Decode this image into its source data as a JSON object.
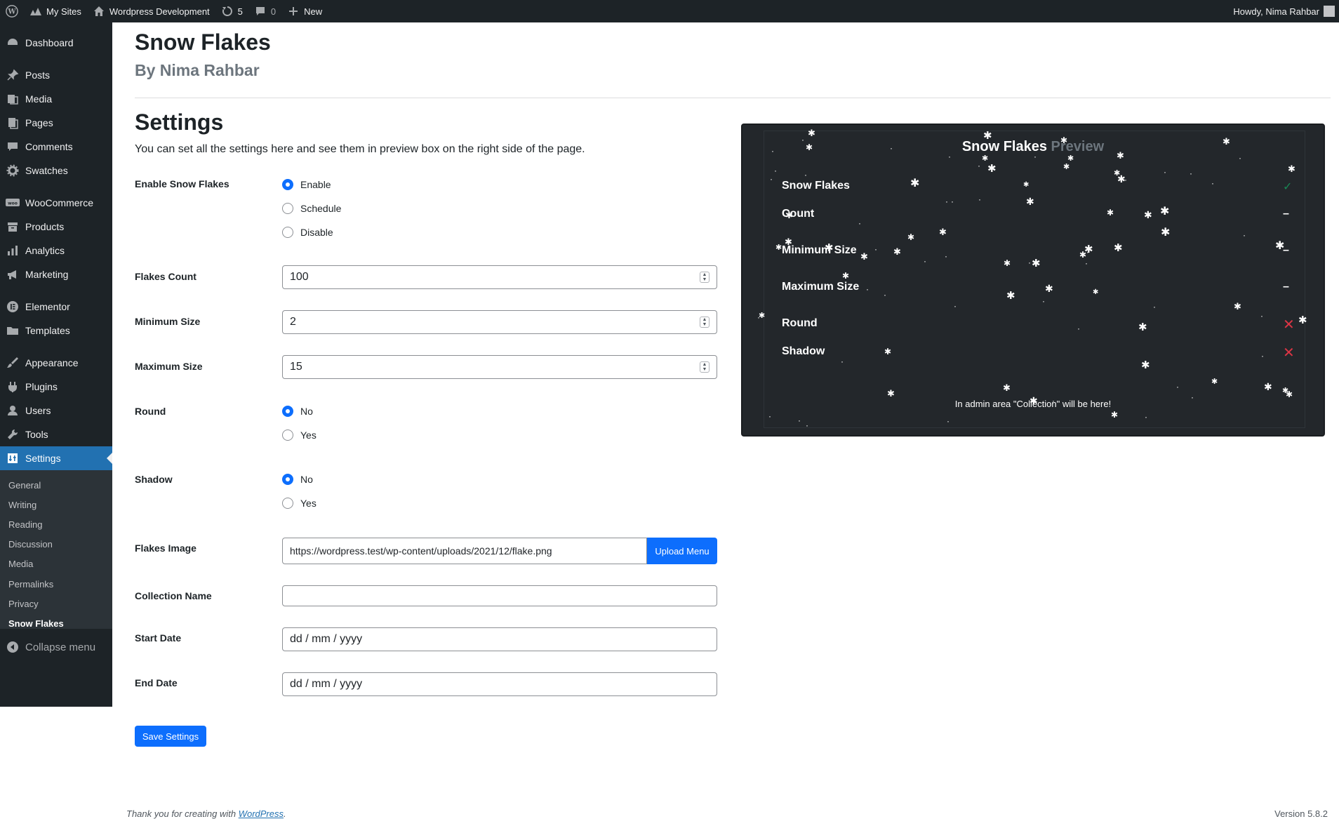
{
  "admin_bar": {
    "my_sites": "My Sites",
    "site_name": "Wordpress Development",
    "updates_count": "5",
    "comments_count": "0",
    "new_label": "New",
    "howdy": "Howdy, Nima Rahbar"
  },
  "sidebar": {
    "items": [
      {
        "label": "Dashboard",
        "icon": "dashboard-icon"
      },
      {
        "label": "Posts",
        "icon": "pin-icon"
      },
      {
        "label": "Media",
        "icon": "media-icon"
      },
      {
        "label": "Pages",
        "icon": "pages-icon"
      },
      {
        "label": "Comments",
        "icon": "comment-icon"
      },
      {
        "label": "Swatches",
        "icon": "gear-icon"
      },
      {
        "label": "WooCommerce",
        "icon": "woo-icon"
      },
      {
        "label": "Products",
        "icon": "archive-icon"
      },
      {
        "label": "Analytics",
        "icon": "bar-chart-icon"
      },
      {
        "label": "Marketing",
        "icon": "megaphone-icon"
      },
      {
        "label": "Elementor",
        "icon": "elementor-icon"
      },
      {
        "label": "Templates",
        "icon": "folder-icon"
      },
      {
        "label": "Appearance",
        "icon": "brush-icon"
      },
      {
        "label": "Plugins",
        "icon": "plug-icon"
      },
      {
        "label": "Users",
        "icon": "user-icon"
      },
      {
        "label": "Tools",
        "icon": "wrench-icon"
      },
      {
        "label": "Settings",
        "icon": "settings-icon"
      }
    ],
    "submenu": [
      "General",
      "Writing",
      "Reading",
      "Discussion",
      "Media",
      "Permalinks",
      "Privacy",
      "Snow Flakes"
    ],
    "collapse": "Collapse menu"
  },
  "page": {
    "plugin_title": "Snow Flakes",
    "plugin_author": "By Nima Rahbar",
    "settings_title": "Settings",
    "description": "You can set all the settings here and see them in preview box on the right side of the page."
  },
  "form": {
    "enable_label": "Enable Snow Flakes",
    "enable_options": [
      "Enable",
      "Schedule",
      "Disable"
    ],
    "flakes_count_label": "Flakes Count",
    "flakes_count_value": "100",
    "min_size_label": "Minimum Size",
    "min_size_value": "2",
    "max_size_label": "Maximum Size",
    "max_size_value": "15",
    "round_label": "Round",
    "round_options": [
      "No",
      "Yes"
    ],
    "shadow_label": "Shadow",
    "shadow_options": [
      "No",
      "Yes"
    ],
    "image_label": "Flakes Image",
    "image_value": "https://wordpress.test/wp-content/uploads/2021/12/flake.png",
    "upload_button": "Upload Menu",
    "collection_label": "Collection Name",
    "collection_value": "",
    "start_date_label": "Start Date",
    "start_date_placeholder": "dd / mm / yyyy",
    "end_date_label": "End Date",
    "end_date_placeholder": "dd / mm / yyyy",
    "save_button": "Save Settings"
  },
  "preview": {
    "title_main": "Snow Flakes",
    "title_fade": "Preview",
    "rows": [
      {
        "label": "Snow Flakes",
        "value": "✓"
      },
      {
        "label": "Count",
        "value": "–"
      },
      {
        "label": "Minimum Size",
        "value": "–"
      },
      {
        "label": "Maximum Size",
        "value": "–"
      },
      {
        "label": "Round",
        "value": "✕"
      },
      {
        "label": "Shadow",
        "value": "✕"
      }
    ],
    "note": "In admin area \"Collection\" will be here!"
  },
  "footer": {
    "thanks_prefix": "Thank you for creating with",
    "wordpress_link": "WordPress",
    "thanks_suffix": ".",
    "version": "Version 5.8.2"
  }
}
